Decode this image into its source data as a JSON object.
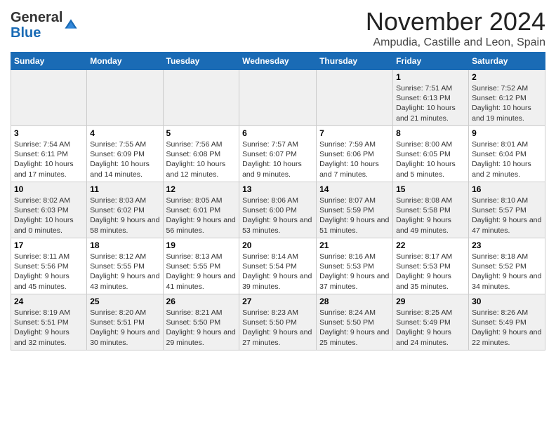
{
  "logo": {
    "general": "General",
    "blue": "Blue"
  },
  "title": "November 2024",
  "subtitle": "Ampudia, Castille and Leon, Spain",
  "days_of_week": [
    "Sunday",
    "Monday",
    "Tuesday",
    "Wednesday",
    "Thursday",
    "Friday",
    "Saturday"
  ],
  "weeks": [
    [
      {
        "day": "",
        "info": ""
      },
      {
        "day": "",
        "info": ""
      },
      {
        "day": "",
        "info": ""
      },
      {
        "day": "",
        "info": ""
      },
      {
        "day": "",
        "info": ""
      },
      {
        "day": "1",
        "info": "Sunrise: 7:51 AM\nSunset: 6:13 PM\nDaylight: 10 hours and 21 minutes."
      },
      {
        "day": "2",
        "info": "Sunrise: 7:52 AM\nSunset: 6:12 PM\nDaylight: 10 hours and 19 minutes."
      }
    ],
    [
      {
        "day": "3",
        "info": "Sunrise: 7:54 AM\nSunset: 6:11 PM\nDaylight: 10 hours and 17 minutes."
      },
      {
        "day": "4",
        "info": "Sunrise: 7:55 AM\nSunset: 6:09 PM\nDaylight: 10 hours and 14 minutes."
      },
      {
        "day": "5",
        "info": "Sunrise: 7:56 AM\nSunset: 6:08 PM\nDaylight: 10 hours and 12 minutes."
      },
      {
        "day": "6",
        "info": "Sunrise: 7:57 AM\nSunset: 6:07 PM\nDaylight: 10 hours and 9 minutes."
      },
      {
        "day": "7",
        "info": "Sunrise: 7:59 AM\nSunset: 6:06 PM\nDaylight: 10 hours and 7 minutes."
      },
      {
        "day": "8",
        "info": "Sunrise: 8:00 AM\nSunset: 6:05 PM\nDaylight: 10 hours and 5 minutes."
      },
      {
        "day": "9",
        "info": "Sunrise: 8:01 AM\nSunset: 6:04 PM\nDaylight: 10 hours and 2 minutes."
      }
    ],
    [
      {
        "day": "10",
        "info": "Sunrise: 8:02 AM\nSunset: 6:03 PM\nDaylight: 10 hours and 0 minutes."
      },
      {
        "day": "11",
        "info": "Sunrise: 8:03 AM\nSunset: 6:02 PM\nDaylight: 9 hours and 58 minutes."
      },
      {
        "day": "12",
        "info": "Sunrise: 8:05 AM\nSunset: 6:01 PM\nDaylight: 9 hours and 56 minutes."
      },
      {
        "day": "13",
        "info": "Sunrise: 8:06 AM\nSunset: 6:00 PM\nDaylight: 9 hours and 53 minutes."
      },
      {
        "day": "14",
        "info": "Sunrise: 8:07 AM\nSunset: 5:59 PM\nDaylight: 9 hours and 51 minutes."
      },
      {
        "day": "15",
        "info": "Sunrise: 8:08 AM\nSunset: 5:58 PM\nDaylight: 9 hours and 49 minutes."
      },
      {
        "day": "16",
        "info": "Sunrise: 8:10 AM\nSunset: 5:57 PM\nDaylight: 9 hours and 47 minutes."
      }
    ],
    [
      {
        "day": "17",
        "info": "Sunrise: 8:11 AM\nSunset: 5:56 PM\nDaylight: 9 hours and 45 minutes."
      },
      {
        "day": "18",
        "info": "Sunrise: 8:12 AM\nSunset: 5:55 PM\nDaylight: 9 hours and 43 minutes."
      },
      {
        "day": "19",
        "info": "Sunrise: 8:13 AM\nSunset: 5:55 PM\nDaylight: 9 hours and 41 minutes."
      },
      {
        "day": "20",
        "info": "Sunrise: 8:14 AM\nSunset: 5:54 PM\nDaylight: 9 hours and 39 minutes."
      },
      {
        "day": "21",
        "info": "Sunrise: 8:16 AM\nSunset: 5:53 PM\nDaylight: 9 hours and 37 minutes."
      },
      {
        "day": "22",
        "info": "Sunrise: 8:17 AM\nSunset: 5:53 PM\nDaylight: 9 hours and 35 minutes."
      },
      {
        "day": "23",
        "info": "Sunrise: 8:18 AM\nSunset: 5:52 PM\nDaylight: 9 hours and 34 minutes."
      }
    ],
    [
      {
        "day": "24",
        "info": "Sunrise: 8:19 AM\nSunset: 5:51 PM\nDaylight: 9 hours and 32 minutes."
      },
      {
        "day": "25",
        "info": "Sunrise: 8:20 AM\nSunset: 5:51 PM\nDaylight: 9 hours and 30 minutes."
      },
      {
        "day": "26",
        "info": "Sunrise: 8:21 AM\nSunset: 5:50 PM\nDaylight: 9 hours and 29 minutes."
      },
      {
        "day": "27",
        "info": "Sunrise: 8:23 AM\nSunset: 5:50 PM\nDaylight: 9 hours and 27 minutes."
      },
      {
        "day": "28",
        "info": "Sunrise: 8:24 AM\nSunset: 5:50 PM\nDaylight: 9 hours and 25 minutes."
      },
      {
        "day": "29",
        "info": "Sunrise: 8:25 AM\nSunset: 5:49 PM\nDaylight: 9 hours and 24 minutes."
      },
      {
        "day": "30",
        "info": "Sunrise: 8:26 AM\nSunset: 5:49 PM\nDaylight: 9 hours and 22 minutes."
      }
    ]
  ]
}
